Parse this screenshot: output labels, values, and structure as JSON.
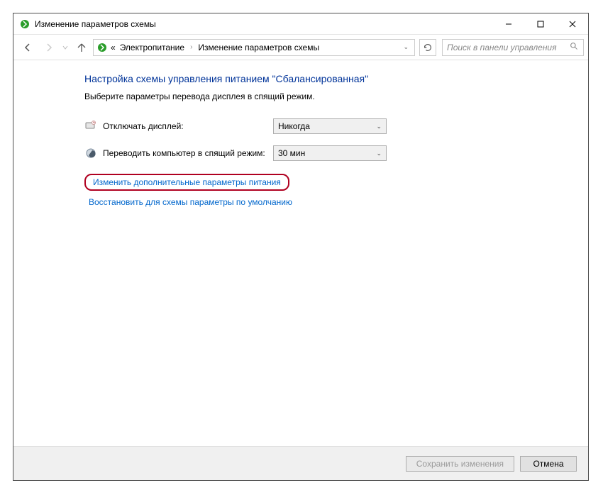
{
  "window": {
    "title": "Изменение параметров схемы"
  },
  "breadcrumb": {
    "level1": "Электропитание",
    "level2": "Изменение параметров схемы",
    "chevrons": "«"
  },
  "search": {
    "placeholder": "Поиск в панели управления"
  },
  "content": {
    "heading": "Настройка схемы управления питанием \"Сбалансированная\"",
    "subtext": "Выберите параметры перевода дисплея в спящий режим.",
    "setting1": {
      "label": "Отключать дисплей:",
      "value": "Никогда"
    },
    "setting2": {
      "label": "Переводить компьютер в спящий режим:",
      "value": "30 мин"
    },
    "link_advanced": "Изменить дополнительные параметры питания",
    "link_restore": "Восстановить для схемы параметры по умолчанию"
  },
  "actions": {
    "save": "Сохранить изменения",
    "cancel": "Отмена"
  }
}
